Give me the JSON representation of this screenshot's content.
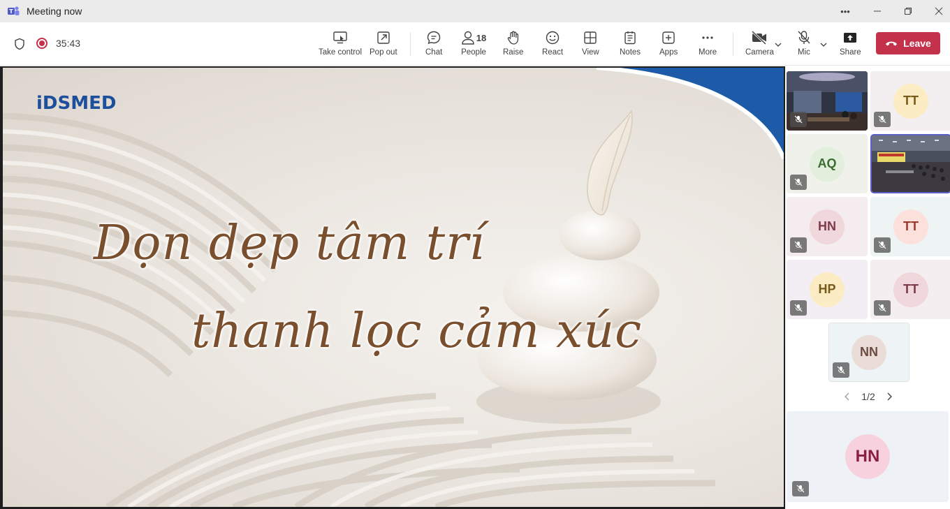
{
  "window": {
    "title": "Meeting now"
  },
  "toolbar": {
    "timer": "35:43",
    "buttons": {
      "take_control": "Take control",
      "pop_out": "Pop out",
      "chat": "Chat",
      "people": "People",
      "people_count": "18",
      "raise": "Raise",
      "react": "React",
      "view": "View",
      "notes": "Notes",
      "apps": "Apps",
      "more": "More",
      "camera": "Camera",
      "mic": "Mic",
      "share": "Share"
    },
    "leave": "Leave"
  },
  "slide": {
    "logo": "iDSMED",
    "line1": "Dọn dẹp tâm trí",
    "line2": "thanh lọc cảm xúc"
  },
  "participants": [
    {
      "initials": "",
      "type": "video"
    },
    {
      "initials": "TT",
      "type": "avatar"
    },
    {
      "initials": "AQ",
      "type": "avatar"
    },
    {
      "initials": "",
      "type": "video"
    },
    {
      "initials": "HN",
      "type": "avatar"
    },
    {
      "initials": "TT",
      "type": "avatar"
    },
    {
      "initials": "HP",
      "type": "avatar"
    },
    {
      "initials": "TT",
      "type": "avatar"
    },
    {
      "initials": "NN",
      "type": "avatar"
    }
  ],
  "pager": {
    "label": "1/2"
  },
  "self_view": {
    "initials": "HN"
  },
  "colors": {
    "leave": "#c4314b",
    "accent": "#6264a7",
    "slide_text": "#7a4f2e",
    "logo": "#1d4f9c"
  }
}
